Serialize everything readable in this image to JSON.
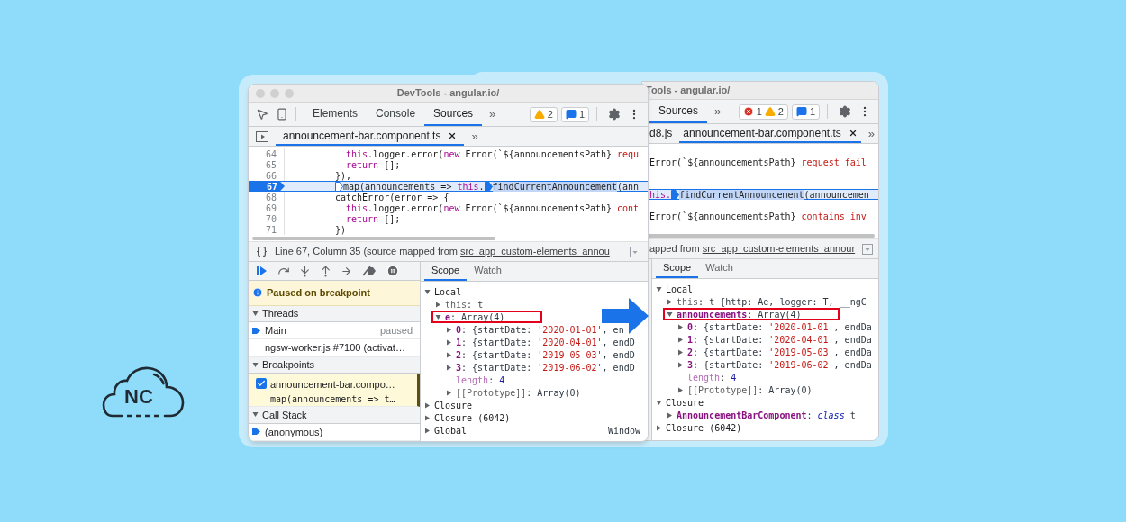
{
  "logo": {
    "text": "NC"
  },
  "left_window": {
    "title": "DevTools - angular.io/",
    "tabs": [
      {
        "label": "Elements",
        "selected": false
      },
      {
        "label": "Console",
        "selected": false
      },
      {
        "label": "Sources",
        "selected": true
      }
    ],
    "more_tabs": "»",
    "badge_groups": [
      {
        "items": [
          {
            "kind": "warning",
            "count": "2"
          }
        ]
      },
      {
        "items": [
          {
            "kind": "message",
            "count": "1"
          }
        ]
      }
    ],
    "file_tabs": [
      {
        "label": "announcement-bar.component.ts",
        "selected": true,
        "closable": true
      }
    ],
    "more_files": "»",
    "code": {
      "lines": [
        {
          "number": "64",
          "kind": "inner",
          "current": false,
          "segments": [
            {
              "kind": "keyword",
              "text": "this"
            },
            {
              "kind": "plain",
              "text": ".logger.error("
            },
            {
              "kind": "keyword",
              "text": "new"
            },
            {
              "kind": "plain",
              "text": " Error(`${announcementsPath} "
            },
            {
              "kind": "string",
              "text": "requ"
            }
          ]
        },
        {
          "number": "65",
          "kind": "inner",
          "current": false,
          "segments": [
            {
              "kind": "keyword",
              "text": "return"
            },
            {
              "kind": "plain",
              "text": " [];"
            }
          ]
        },
        {
          "number": "66",
          "kind": "outer",
          "current": false,
          "segments": [
            {
              "kind": "plain",
              "text": "}),"
            }
          ]
        },
        {
          "number": "67",
          "kind": "outer",
          "current": true,
          "segments": [
            {
              "kind": "marker",
              "active": false
            },
            {
              "kind": "plain",
              "text": "map(announcements => "
            },
            {
              "kind": "keyword",
              "text": "this"
            },
            {
              "kind": "plain",
              "text": "."
            },
            {
              "kind": "marker",
              "active": true
            },
            {
              "kind": "highlight",
              "text": "findCurrentAnnouncement"
            },
            {
              "kind": "plain",
              "text": "(ann"
            }
          ]
        },
        {
          "number": "68",
          "kind": "outer",
          "current": false,
          "segments": [
            {
              "kind": "plain",
              "text": "catchError(error => {"
            }
          ]
        },
        {
          "number": "69",
          "kind": "inner",
          "current": false,
          "segments": [
            {
              "kind": "keyword",
              "text": "this"
            },
            {
              "kind": "plain",
              "text": ".logger.error("
            },
            {
              "kind": "keyword",
              "text": "new"
            },
            {
              "kind": "plain",
              "text": " Error(`${announcementsPath} "
            },
            {
              "kind": "string",
              "text": "cont"
            }
          ]
        },
        {
          "number": "70",
          "kind": "inner",
          "current": false,
          "segments": [
            {
              "kind": "keyword",
              "text": "return"
            },
            {
              "kind": "plain",
              "text": " [];"
            }
          ]
        },
        {
          "number": "71",
          "kind": "outer",
          "current": false,
          "segments": [
            {
              "kind": "plain",
              "text": "})"
            }
          ]
        }
      ]
    },
    "status": {
      "text": "Line 67, Column 35 (source mapped from ",
      "link": "src_app_custom-elements_annou"
    },
    "debugger": {
      "paused_message": "Paused on breakpoint",
      "sections": [
        {
          "title": "Threads",
          "expanded": true,
          "items": [
            {
              "kind": "thread",
              "label": "Main",
              "status": "paused",
              "selected": true
            },
            {
              "kind": "thread",
              "label": "ngsw-worker.js #7100 (activat…",
              "selected": false
            }
          ]
        },
        {
          "title": "Breakpoints",
          "expanded": true,
          "items": [
            {
              "kind": "breakpoint",
              "label": "announcement-bar.compo…",
              "code": "map(announcements => t…",
              "checked": true
            }
          ]
        },
        {
          "title": "Call Stack",
          "expanded": true,
          "items": [
            {
              "kind": "frame",
              "label": "(anonymous)",
              "selected": true
            }
          ]
        }
      ]
    },
    "scope": {
      "tabs": [
        {
          "label": "Scope",
          "selected": true
        },
        {
          "label": "Watch",
          "selected": false
        }
      ],
      "tree": [
        {
          "kind": "scope",
          "name": "Local",
          "expanded": true,
          "children": [
            {
              "kind": "internal",
              "name": "this",
              "value": [
                {
                  "kind": "plain",
                  "text": ": t"
                }
              ],
              "expanded": false
            },
            {
              "kind": "property",
              "name": "e",
              "value": [
                {
                  "kind": "plain",
                  "text": ": Array(4)"
                }
              ],
              "expanded": true,
              "boxed": true,
              "children": [
                {
                  "kind": "property",
                  "name": "0",
                  "value": [
                    {
                      "kind": "plain",
                      "text": ": {startDate: "
                    },
                    {
                      "kind": "string",
                      "text": "'2020-01-01'"
                    },
                    {
                      "kind": "plain",
                      "text": ", en"
                    }
                  ],
                  "expanded": false
                },
                {
                  "kind": "property",
                  "name": "1",
                  "value": [
                    {
                      "kind": "plain",
                      "text": ": {startDate: "
                    },
                    {
                      "kind": "string",
                      "text": "'2020-04-01'"
                    },
                    {
                      "kind": "plain",
                      "text": ", endD"
                    }
                  ],
                  "expanded": false
                },
                {
                  "kind": "property",
                  "name": "2",
                  "value": [
                    {
                      "kind": "plain",
                      "text": ": {startDate: "
                    },
                    {
                      "kind": "string",
                      "text": "'2019-05-03'"
                    },
                    {
                      "kind": "plain",
                      "text": ", endD"
                    }
                  ],
                  "expanded": false
                },
                {
                  "kind": "property",
                  "name": "3",
                  "value": [
                    {
                      "kind": "plain",
                      "text": ": {startDate: "
                    },
                    {
                      "kind": "string",
                      "text": "'2019-06-02'"
                    },
                    {
                      "kind": "plain",
                      "text": ", endD"
                    }
                  ],
                  "expanded": false
                },
                {
                  "kind": "leaf",
                  "name": "length",
                  "value": [
                    {
                      "kind": "plain",
                      "text": ": "
                    },
                    {
                      "kind": "number",
                      "text": "4"
                    }
                  ]
                },
                {
                  "kind": "internal",
                  "name": "[[Prototype]]",
                  "value": [
                    {
                      "kind": "plain",
                      "text": ": Array(0)"
                    }
                  ],
                  "expanded": false
                }
              ]
            }
          ]
        },
        {
          "kind": "scope",
          "name": "Closure",
          "expanded": false
        },
        {
          "kind": "scope",
          "name": "Closure (6042)",
          "expanded": false
        },
        {
          "kind": "scope",
          "name": "Global",
          "expanded": false,
          "extra": "Window"
        }
      ]
    }
  },
  "right_window": {
    "title": "Tools - angular.io/",
    "tabs": [
      {
        "label": "Sources",
        "selected": true
      }
    ],
    "more_tabs": "»",
    "badge_groups": [
      {
        "items": [
          {
            "kind": "error",
            "count": "1"
          },
          {
            "kind": "warning",
            "count": "2"
          }
        ]
      },
      {
        "items": [
          {
            "kind": "message",
            "count": "1"
          }
        ]
      }
    ],
    "file_tabs": [
      {
        "label": "d8.js",
        "selected": false,
        "closable": false
      },
      {
        "label": "announcement-bar.component.ts",
        "selected": true,
        "closable": true
      }
    ],
    "more_files": "»",
    "code": {
      "lines": [
        {
          "current": false
        },
        {
          "current": false,
          "segments": [
            {
              "kind": "plain",
              "text": "Error(`${announcementsPath} "
            },
            {
              "kind": "string",
              "text": "request fail"
            }
          ]
        },
        {
          "current": false
        },
        {
          "current": false
        },
        {
          "current": true,
          "segments": [
            {
              "kind": "keyword",
              "text": "his."
            },
            {
              "kind": "marker",
              "active": true
            },
            {
              "kind": "highlight",
              "text": "findCurrentAnnouncement"
            },
            {
              "kind": "plain",
              "text": "(announcemen"
            }
          ]
        },
        {
          "current": false
        },
        {
          "current": false,
          "segments": [
            {
              "kind": "plain",
              "text": "Error(`${announcementsPath} "
            },
            {
              "kind": "string",
              "text": "contains inv"
            }
          ]
        },
        {
          "current": false
        }
      ]
    },
    "status": {
      "text": "apped from ",
      "link": "src_app_custom-elements_annour"
    },
    "scope": {
      "tabs": [
        {
          "label": "Scope",
          "selected": true
        },
        {
          "label": "Watch",
          "selected": false
        }
      ],
      "tree": [
        {
          "kind": "scope",
          "name": "Local",
          "expanded": true,
          "children": [
            {
              "kind": "internal",
              "name": "this",
              "value": [
                {
                  "kind": "plain",
                  "text": ": t {http: Ae, logger: T, __ngC"
                }
              ],
              "expanded": false
            },
            {
              "kind": "property",
              "name": "announcements",
              "value": [
                {
                  "kind": "plain",
                  "text": ": Array(4)"
                }
              ],
              "expanded": true,
              "boxed": true,
              "children": [
                {
                  "kind": "property",
                  "name": "0",
                  "value": [
                    {
                      "kind": "plain",
                      "text": ": {startDate: "
                    },
                    {
                      "kind": "string",
                      "text": "'2020-01-01'"
                    },
                    {
                      "kind": "plain",
                      "text": ", endDa"
                    }
                  ],
                  "expanded": false
                },
                {
                  "kind": "property",
                  "name": "1",
                  "value": [
                    {
                      "kind": "plain",
                      "text": ": {startDate: "
                    },
                    {
                      "kind": "string",
                      "text": "'2020-04-01'"
                    },
                    {
                      "kind": "plain",
                      "text": ", endDa"
                    }
                  ],
                  "expanded": false
                },
                {
                  "kind": "property",
                  "name": "2",
                  "value": [
                    {
                      "kind": "plain",
                      "text": ": {startDate: "
                    },
                    {
                      "kind": "string",
                      "text": "'2019-05-03'"
                    },
                    {
                      "kind": "plain",
                      "text": ", endDa"
                    }
                  ],
                  "expanded": false
                },
                {
                  "kind": "property",
                  "name": "3",
                  "value": [
                    {
                      "kind": "plain",
                      "text": ": {startDate: "
                    },
                    {
                      "kind": "string",
                      "text": "'2019-06-02'"
                    },
                    {
                      "kind": "plain",
                      "text": ", endDa"
                    }
                  ],
                  "expanded": false
                },
                {
                  "kind": "leaf",
                  "name": "length",
                  "value": [
                    {
                      "kind": "plain",
                      "text": ": "
                    },
                    {
                      "kind": "number",
                      "text": "4"
                    }
                  ]
                },
                {
                  "kind": "internal",
                  "name": "[[Prototype]]",
                  "value": [
                    {
                      "kind": "plain",
                      "text": ": Array(0)"
                    }
                  ],
                  "expanded": false
                }
              ]
            }
          ]
        },
        {
          "kind": "scope",
          "name": "Closure",
          "expanded": true,
          "children": [
            {
              "kind": "property",
              "name": "AnnouncementBarComponent",
              "value": [
                {
                  "kind": "plain",
                  "text": ": "
                },
                {
                  "kind": "keyword",
                  "text": "class"
                },
                {
                  "kind": "plain",
                  "text": " t"
                }
              ],
              "expanded": false
            }
          ]
        },
        {
          "kind": "scope",
          "name": "Closure (6042)",
          "expanded": false
        }
      ]
    }
  }
}
